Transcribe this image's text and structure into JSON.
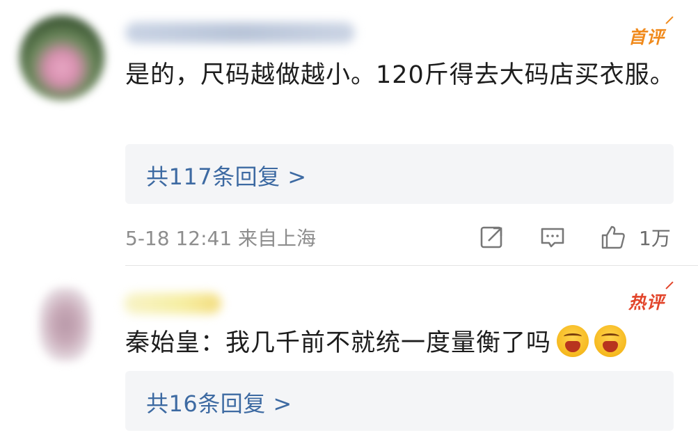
{
  "comments": [
    {
      "tag": "首评",
      "text": "是的，尺码越做越小。120斤得去大码店买衣服。",
      "replies": "共117条回复 >",
      "meta": {
        "time_location": "5-18 12:41 来自上海",
        "like_count": "1万"
      }
    },
    {
      "tag": "热评",
      "text": "秦始皇：我几千前不就统一度量衡了吗",
      "emojis": [
        "laughing-crying-icon",
        "laughing-crying-icon"
      ],
      "replies": "共16条回复 >"
    }
  ],
  "colors": {
    "tag_first": "#f08a1c",
    "tag_hot": "#e2452b",
    "link": "#3d6aa2",
    "meta": "#8d8d8d",
    "reply_bg": "#f4f5f7"
  }
}
